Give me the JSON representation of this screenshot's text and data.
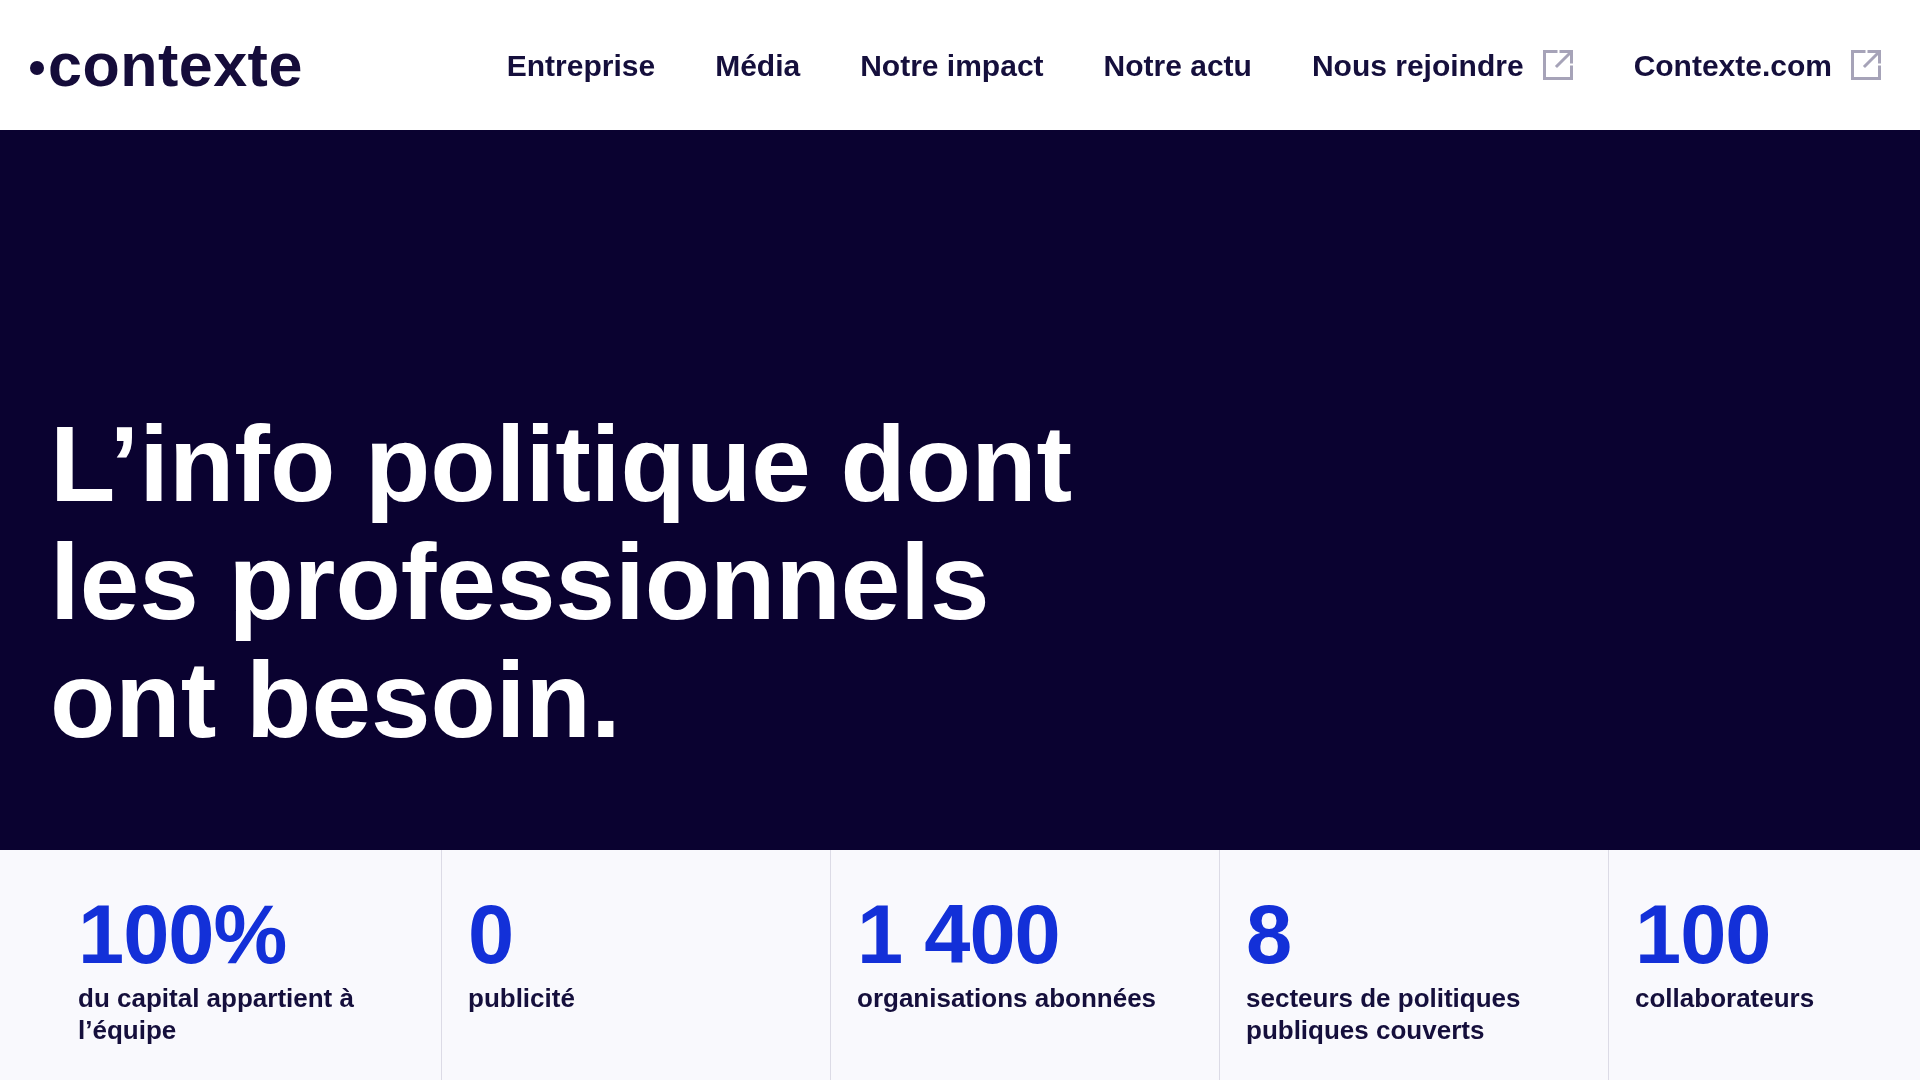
{
  "header": {
    "logo": "contexte",
    "nav": [
      {
        "label": "Entreprise",
        "external": false
      },
      {
        "label": "Média",
        "external": false
      },
      {
        "label": "Notre impact",
        "external": false
      },
      {
        "label": "Notre actu",
        "external": false
      },
      {
        "label": "Nous rejoindre",
        "external": true
      },
      {
        "label": "Contexte.com",
        "external": true
      }
    ]
  },
  "hero": {
    "headline_lines": [
      "L’info politique dont",
      "les professionnels",
      "ont besoin."
    ]
  },
  "stats": [
    {
      "value": "100%",
      "label": "du capital appartient à l’équipe"
    },
    {
      "value": "0",
      "label": "publicité"
    },
    {
      "value": "1 400",
      "label": "organisations abonnées"
    },
    {
      "value": "8",
      "label": "secteurs de politiques publiques couverts"
    },
    {
      "value": "100",
      "label": "collaborateurs"
    }
  ]
}
